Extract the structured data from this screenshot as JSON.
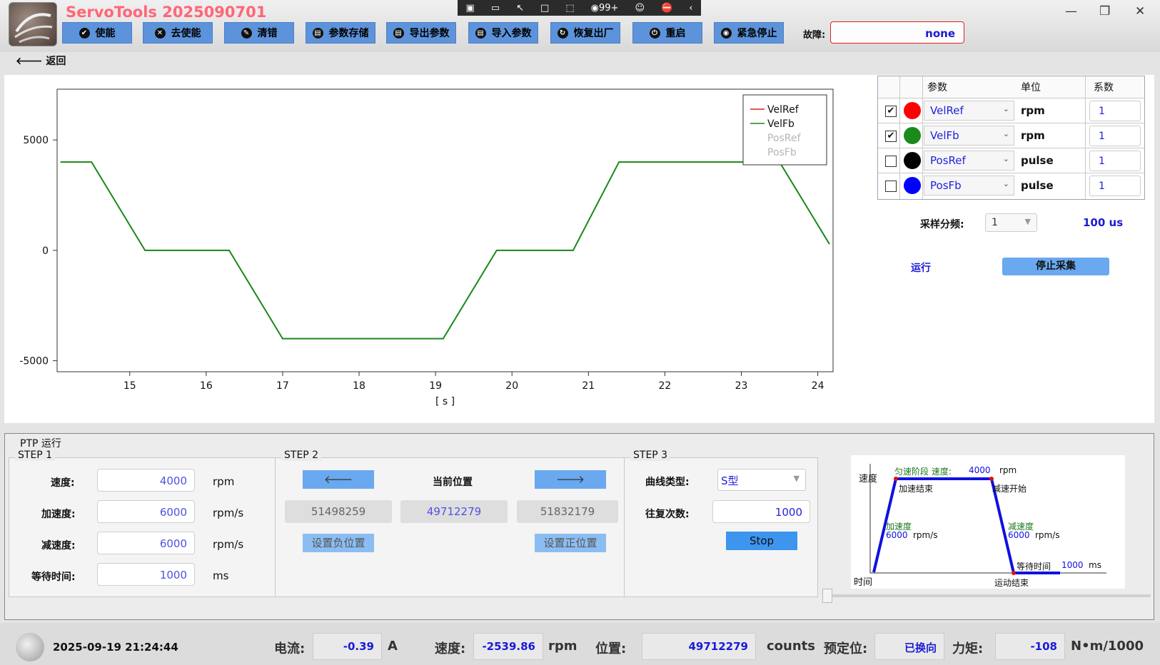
{
  "app": {
    "title": "ServoTools 2025090701"
  },
  "toolbar": [
    {
      "label": "使能",
      "icon": "check-circle-icon"
    },
    {
      "label": "去使能",
      "icon": "x-circle-icon"
    },
    {
      "label": "清错",
      "icon": "eraser-icon"
    },
    {
      "label": "参数存储",
      "icon": "save-icon"
    },
    {
      "label": "导出参数",
      "icon": "save-icon"
    },
    {
      "label": "导入参数",
      "icon": "save-icon"
    },
    {
      "label": "恢复出厂",
      "icon": "refresh-icon"
    },
    {
      "label": "重启",
      "icon": "power-icon"
    },
    {
      "label": "紧急停止",
      "icon": "stop-icon"
    }
  ],
  "overlay": {
    "badge": "99+"
  },
  "fault": {
    "label": "故障:",
    "value": "none"
  },
  "nav": {
    "back": "返回"
  },
  "chart_data": {
    "type": "line",
    "xlabel": "[ s ]",
    "xlim": [
      14.05,
      24.2
    ],
    "ylim": [
      -5500,
      7300
    ],
    "xticks": [
      15,
      16,
      17,
      18,
      19,
      20,
      21,
      22,
      23,
      24
    ],
    "yticks": [
      5000,
      0,
      -5000
    ],
    "legend": [
      "VelRef",
      "VelFb",
      "PosRef",
      "PosFb"
    ],
    "legend_position": "top-right",
    "series": [
      {
        "name": "VelRef",
        "color": "#e02020",
        "x": [
          14.1,
          14.5,
          15.2,
          16.3,
          17.0,
          19.1,
          19.8,
          20.8,
          21.4,
          23.5,
          24.15
        ],
        "y": [
          4000,
          4000,
          0,
          0,
          -4000,
          -4000,
          0,
          0,
          4000,
          4000,
          300
        ]
      },
      {
        "name": "VelFb",
        "color": "#1a8a1a",
        "x": [
          14.1,
          14.5,
          15.2,
          16.3,
          17.0,
          19.1,
          19.8,
          20.8,
          21.4,
          23.5,
          24.15
        ],
        "y": [
          4000,
          4000,
          0,
          0,
          -4000,
          -4000,
          0,
          0,
          4000,
          4000,
          300
        ]
      }
    ]
  },
  "channels": {
    "headers": [
      "参数",
      "单位",
      "系数"
    ],
    "rows": [
      {
        "checked": true,
        "color": "#ff0000",
        "name": "VelRef",
        "unit": "rpm",
        "coef": "1"
      },
      {
        "checked": true,
        "color": "#1a8a1a",
        "name": "VelFb",
        "unit": "rpm",
        "coef": "1"
      },
      {
        "checked": false,
        "color": "#000000",
        "name": "PosRef",
        "unit": "pulse",
        "coef": "1"
      },
      {
        "checked": false,
        "color": "#0000ff",
        "name": "PosFb",
        "unit": "pulse",
        "coef": "1"
      }
    ]
  },
  "sampling": {
    "label": "采样分频:",
    "value": "1",
    "period": "100 us",
    "run": "运行",
    "stop": "停止采集"
  },
  "ptp": {
    "title": "PTP 运行",
    "step1": {
      "title": "STEP 1",
      "speed_label": "速度:",
      "speed": "4000",
      "speed_unit": "rpm",
      "acc_label": "加速度:",
      "acc": "6000",
      "acc_unit": "rpm/s",
      "dec_label": "减速度:",
      "dec": "6000",
      "dec_unit": "rpm/s",
      "wait_label": "等待时间:",
      "wait": "1000",
      "wait_unit": "ms"
    },
    "step2": {
      "title": "STEP 2",
      "current_label": "当前位置",
      "neg_pos": "51498259",
      "cur_pos": "49712279",
      "pos_pos": "51832179",
      "set_neg": "设置负位置",
      "set_pos": "设置正位置"
    },
    "step3": {
      "title": "STEP 3",
      "curve_label": "曲线类型:",
      "curve": "S型",
      "repeat_label": "往复次数:",
      "repeat": "1000",
      "stop": "Stop"
    },
    "diagram": {
      "speed_axis": "速度",
      "time_axis": "时间",
      "const_label": "匀速阶段 速度:",
      "const_value": "4000",
      "const_unit": "rpm",
      "acc_end": "加速结束",
      "dec_start": "减速开始",
      "acc_label": "加速度",
      "acc_value": "6000",
      "acc_unit": "rpm/s",
      "dec_label": "减速度",
      "dec_value": "6000",
      "dec_unit": "rpm/s",
      "wait_label": "等待时间",
      "wait_value": "1000",
      "wait_unit": "ms",
      "motion_end": "运动结束"
    }
  },
  "status": {
    "datetime": "2025-09-19 21:24:44",
    "current_label": "电流:",
    "current": "-0.39",
    "current_unit": "A",
    "speed_label": "速度:",
    "speed": "-2539.86",
    "speed_unit": "rpm",
    "position_label": "位置:",
    "position": "49712279",
    "position_unit": "counts",
    "preset_label": "预定位:",
    "preset": "已换向",
    "torque_label": "力矩:",
    "torque": "-108",
    "torque_unit": "N•m/1000"
  }
}
